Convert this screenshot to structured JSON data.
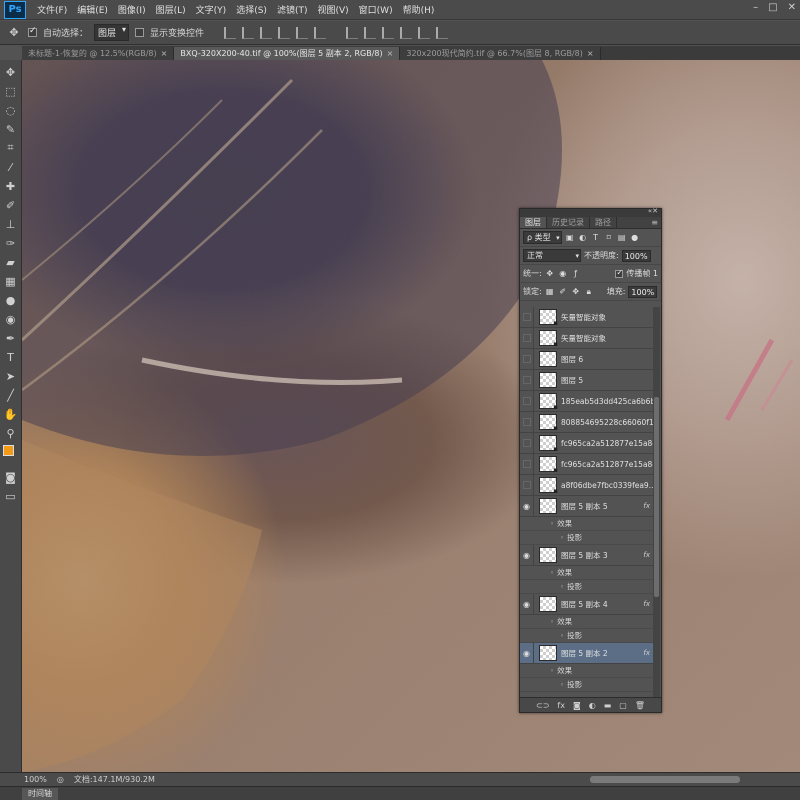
{
  "app": {
    "logo": "Ps",
    "menus": [
      "文件(F)",
      "编辑(E)",
      "图像(I)",
      "图层(L)",
      "文字(Y)",
      "选择(S)",
      "滤镜(T)",
      "视图(V)",
      "窗口(W)",
      "帮助(H)"
    ],
    "window_controls": [
      "–",
      "□",
      "✕"
    ]
  },
  "options": {
    "auto_select_label": "自动选择：",
    "auto_select_checked": true,
    "auto_select_target": "图层",
    "show_transform_label": "显示变换控件",
    "show_transform_checked": false
  },
  "tabs": [
    {
      "title": "未标题-1-恢复的 @ 12.5%(RGB/8)",
      "active": false
    },
    {
      "title": "BXQ-320X200-40.tif @ 100%(图层 5 副本 2, RGB/8)",
      "active": true
    },
    {
      "title": "320x200现代简约.tif @ 66.7%(图层 8, RGB/8)",
      "active": false
    }
  ],
  "tools": [
    "move-tool",
    "marquee-tool",
    "lasso-tool",
    "quick-select-tool",
    "crop-tool",
    "eyedropper-tool",
    "spot-heal-tool",
    "brush-tool",
    "clone-stamp-tool",
    "history-brush-tool",
    "eraser-tool",
    "gradient-tool",
    "blur-tool",
    "dodge-tool",
    "pen-tool",
    "type-tool",
    "path-select-tool",
    "shape-tool",
    "hand-tool",
    "zoom-tool"
  ],
  "colors": {
    "foreground": "#f39a16",
    "background": "#111111",
    "accent_selection": "#5b6e86"
  },
  "status": {
    "zoom": "100%",
    "doc_info": "文档:147.1M/930.2M"
  },
  "timeline_tab": "时间轴",
  "layers_panel": {
    "tabs": [
      "图层",
      "历史记录",
      "路径"
    ],
    "active_tab": "图层",
    "filter_label": "ρ 类型",
    "blend_mode": "正常",
    "opacity_label": "不透明度:",
    "opacity_value": "100%",
    "unify_label": "统一:",
    "propagate_label": "传播帧 1",
    "propagate_checked": true,
    "lock_label": "锁定:",
    "fill_label": "填充:",
    "fill_value": "100%",
    "layers": [
      {
        "name": "矢量智能对象",
        "visible": false,
        "smart": true,
        "fx": false,
        "selected": false,
        "effects": []
      },
      {
        "name": "矢量智能对象",
        "visible": false,
        "smart": true,
        "fx": false,
        "selected": false,
        "effects": []
      },
      {
        "name": "图层 6",
        "visible": false,
        "smart": false,
        "fx": false,
        "selected": false,
        "effects": []
      },
      {
        "name": "图层 5",
        "visible": false,
        "smart": false,
        "fx": false,
        "selected": false,
        "effects": []
      },
      {
        "name": "185eab5d3dd425ca6b6b...",
        "visible": false,
        "smart": true,
        "fx": false,
        "selected": false,
        "effects": []
      },
      {
        "name": "808854695228c66060f1...",
        "visible": false,
        "smart": true,
        "fx": false,
        "selected": false,
        "effects": []
      },
      {
        "name": "fc965ca2a512877e15a8c...",
        "visible": false,
        "smart": true,
        "fx": false,
        "selected": false,
        "effects": []
      },
      {
        "name": "fc965ca2a512877e15a8c...",
        "visible": false,
        "smart": true,
        "fx": false,
        "selected": false,
        "effects": []
      },
      {
        "name": "a8f06dbe7fbc0339fea9...",
        "visible": false,
        "smart": true,
        "fx": false,
        "selected": false,
        "effects": []
      },
      {
        "name": "图层 5 副本 5",
        "visible": true,
        "smart": false,
        "fx": true,
        "selected": false,
        "effects": [
          "效果",
          "投影"
        ]
      },
      {
        "name": "图层 5 副本 3",
        "visible": true,
        "smart": false,
        "fx": true,
        "selected": false,
        "effects": [
          "效果",
          "投影"
        ]
      },
      {
        "name": "图层 5 副本 4",
        "visible": true,
        "smart": false,
        "fx": true,
        "selected": false,
        "effects": [
          "效果",
          "投影"
        ]
      },
      {
        "name": "图层 5 副本 2",
        "visible": true,
        "smart": false,
        "fx": true,
        "selected": true,
        "effects": [
          "效果",
          "投影"
        ]
      }
    ],
    "fx_symbol": "fx",
    "footer_icons": [
      "link-icon",
      "fx-icon",
      "mask-icon",
      "adjustment-icon",
      "folder-icon",
      "new-layer-icon",
      "trash-icon"
    ]
  }
}
